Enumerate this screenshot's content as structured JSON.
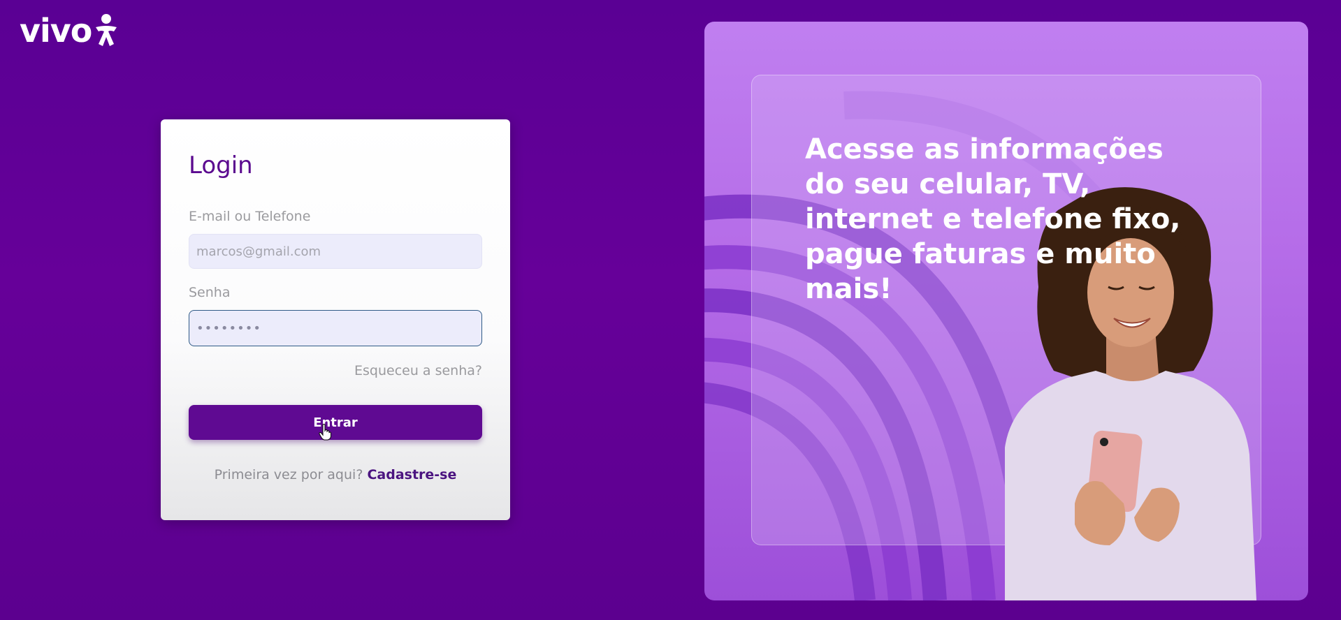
{
  "brand": {
    "logo_text": "vivo",
    "logo_icon": "vivo-person-icon",
    "color": "#660099"
  },
  "login": {
    "title": "Login",
    "email_label": "E-mail ou Telefone",
    "email_placeholder": "marcos@gmail.com",
    "email_value": "",
    "password_label": "Senha",
    "password_value": "••••••••",
    "forgot_link": "Esqueceu a senha?",
    "submit_label": "Entrar",
    "signup_prompt": "Primeira vez por aqui?",
    "signup_link": "Cadastre-se"
  },
  "promo": {
    "headline": "Acesse as informações do seu celular, TV, internet e telefone fixo, pague faturas e muito mais!"
  },
  "colors": {
    "accent": "#5f0a92",
    "title": "#5b0a8f",
    "panel": "#b56ce8"
  }
}
